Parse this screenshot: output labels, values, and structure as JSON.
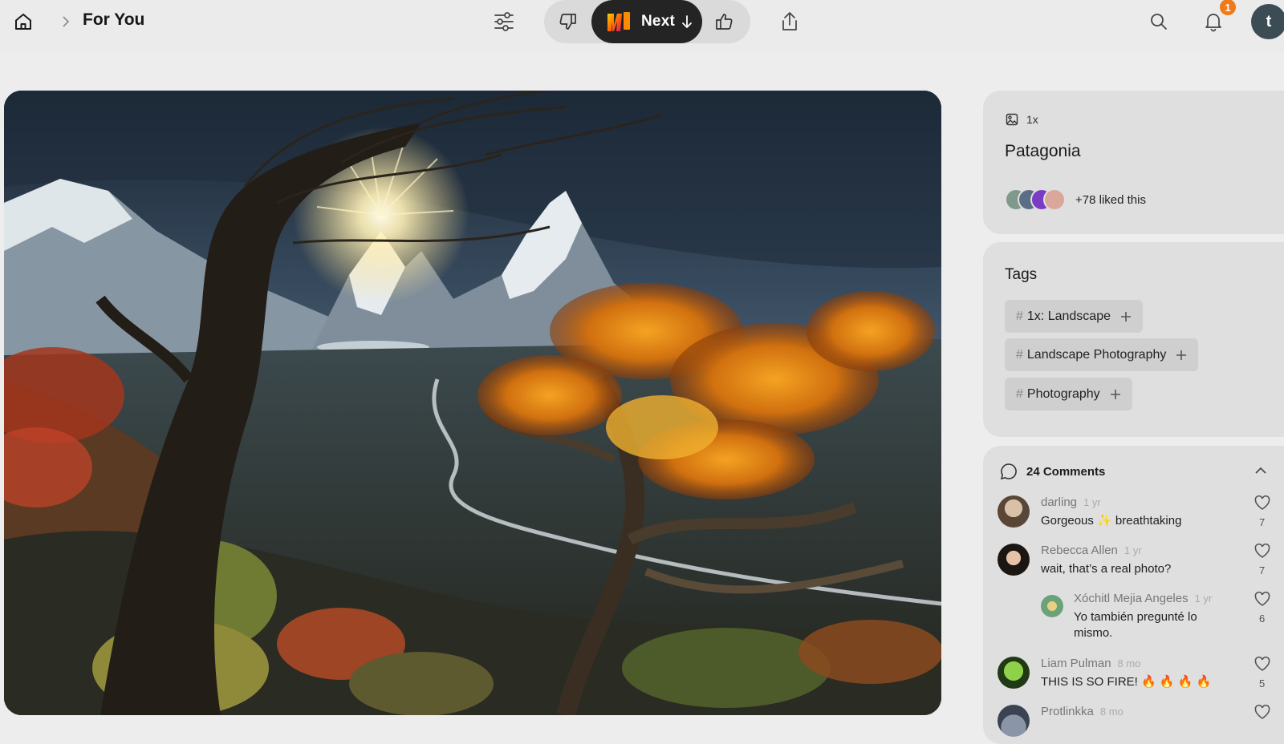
{
  "header": {
    "breadcrumb_title": "For You",
    "next_label": "Next",
    "notification_count": "1",
    "user_initial": "t"
  },
  "post": {
    "image_count": "1x",
    "title": "Patagonia",
    "liked_text": "+78 liked this"
  },
  "tags": {
    "title": "Tags",
    "items": [
      {
        "hash": "#",
        "label": "1x: Landscape"
      },
      {
        "hash": "#",
        "label": "Landscape Photography"
      },
      {
        "hash": "#",
        "label": "Photography"
      }
    ]
  },
  "comments": {
    "header": "24 Comments",
    "items": [
      {
        "author": "darling",
        "time": "1 yr",
        "text": "Gorgeous ✨ breathtaking",
        "likes": "7"
      },
      {
        "author": "Rebecca Allen",
        "time": "1 yr",
        "text": "wait, that’s a real photo?",
        "likes": "7"
      },
      {
        "author": "Xóchitl Mejia Angeles",
        "time": "1 yr",
        "text": "Yo también pregunté lo mismo.",
        "likes": "6"
      },
      {
        "author": "Liam Pulman",
        "time": "8 mo",
        "text": "THIS IS SO FIRE! 🔥 🔥 🔥 🔥",
        "likes": "5"
      },
      {
        "author": "Protlinkka",
        "time": "8 mo",
        "text": "",
        "likes": ""
      }
    ]
  },
  "colors": {
    "accent": "#f07a18",
    "next_button_bg": "#242424",
    "panel_bg": "#dfdfdf",
    "page_bg": "#ededed"
  },
  "icons": {
    "home": "home-icon",
    "filter": "sliders-icon",
    "dislike": "thumbs-down-icon",
    "like": "thumbs-up-icon",
    "share": "share-icon",
    "search": "search-icon",
    "notifications": "bell-icon",
    "comments": "speech-bubble-icon",
    "heart": "heart-icon"
  }
}
